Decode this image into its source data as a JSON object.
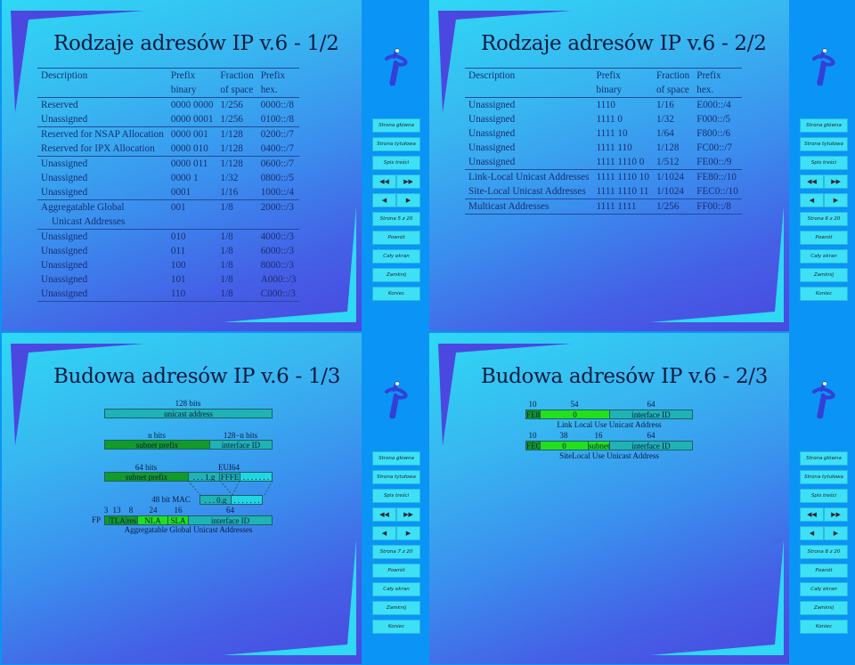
{
  "nav": {
    "home": "Strona główna",
    "title_page": "Strona tytułowa",
    "toc": "Spis treści",
    "first": "◀◀",
    "last": "▶▶",
    "prev": "◀",
    "next": "▶",
    "back": "Powrót",
    "fullscreen": "Cały ekran",
    "close": "Zamknij",
    "end": "Koniec"
  },
  "colors": {
    "sidebar": "#0a94f5",
    "button": "#3ee0f5",
    "teal": "#1fb3b5",
    "dark_green": "#129b28",
    "light_green": "#22e01e"
  },
  "slides": [
    {
      "title": "Rodzaje adresów IP v.6 - 1/2",
      "page": "Strona 5 z 20",
      "headers": [
        [
          "Description",
          ""
        ],
        [
          "Prefix",
          "binary"
        ],
        [
          "Fraction",
          "of space"
        ],
        [
          "Prefix",
          "hex."
        ]
      ],
      "rows": [
        [
          "Reserved",
          "0000 0000",
          "1/256",
          "0000::/8"
        ],
        [
          "Unassigned",
          "0000 0001",
          "1/256",
          "0100::/8"
        ],
        [
          "Reserved for NSAP Allocation",
          "0000 001",
          "1/128",
          "0200::/7"
        ],
        [
          "Reserved for IPX Allocation",
          "0000 010",
          "1/128",
          "0400::/7"
        ],
        [
          "Unassigned",
          "0000 011",
          "1/128",
          "0600::/7"
        ],
        [
          "Unassigned",
          "0000 1",
          "1/32",
          "0800::/5"
        ],
        [
          "Unassigned",
          "0001",
          "1/16",
          "1000::/4"
        ],
        [
          "Aggregatable Global",
          "001",
          "1/8",
          "2000::/3"
        ],
        [
          "  Unicast Addresses",
          "",
          "",
          ""
        ],
        [
          "Unassigned",
          "010",
          "1/8",
          "4000::/3"
        ],
        [
          "Unassigned",
          "011",
          "1/8",
          "6000::/3"
        ],
        [
          "Unassigned",
          "100",
          "1/8",
          "8000::/3"
        ],
        [
          "Unassigned",
          "101",
          "1/8",
          "A000::/3"
        ],
        [
          "Unassigned",
          "110",
          "1/8",
          "C000::/3"
        ]
      ]
    },
    {
      "title": "Rodzaje adresów IP v.6 - 2/2",
      "page": "Strona 6 z 20",
      "headers": [
        [
          "Description",
          ""
        ],
        [
          "Prefix",
          "binary"
        ],
        [
          "Fraction",
          "of space"
        ],
        [
          "Prefix",
          "hex."
        ]
      ],
      "rows": [
        [
          "Unassigned",
          "1110",
          "1/16",
          "E000::/4"
        ],
        [
          "Unassigned",
          "1111 0",
          "1/32",
          "F000::/5"
        ],
        [
          "Unassigned",
          "1111 10",
          "1/64",
          "F800::/6"
        ],
        [
          "Unassigned",
          "1111 110",
          "1/128",
          "FC00::/7"
        ],
        [
          "Unassigned",
          "1111 1110 0",
          "1/512",
          "FE00::/9"
        ],
        [
          "Link-Local Unicast Addresses",
          "1111 1110 10",
          "1/1024",
          "FE80::/10"
        ],
        [
          "Site-Local Unicast Addresses",
          "1111 1110 11",
          "1/1024",
          "FEC0::/10"
        ],
        [
          "Multicast Addresses",
          "1111 1111",
          "1/256",
          "FF00::/8"
        ]
      ]
    },
    {
      "title": "Budowa adresów IP v.6 - 1/3",
      "page": "Strona 7 z 20",
      "diagram": {
        "bits128": "128 bits",
        "unicast": "unicast address",
        "nbits": "n bits",
        "n128": "128−n bits",
        "subnet_prefix": "subnet prefix",
        "interface_id": "interface ID",
        "bits64": "64 bits",
        "eui64": "EUI64",
        "subnet_prefix2": "subnet prefix",
        "dots1g": ". . . 1.g",
        "fffe": "FFFE",
        "dots_end": ". . . . . . .",
        "mac": "48 bit MAC",
        "dots0g": ". . . 0.g",
        "dots_mac_end": ". . . . . . .",
        "n3": "3",
        "n13": "13",
        "n8": "8",
        "n24": "24",
        "n16": "16",
        "n64": "64",
        "fp": "FP",
        "tla": "TLA",
        "res": "res",
        "nla": "NLA",
        "sla": "SLA",
        "interface_id2": "interface ID",
        "caption": "Aggregatable Global Unicast Addresses"
      }
    },
    {
      "title": "Budowa adresów IP v.6 - 2/3",
      "page": "Strona 8 z 20",
      "diagram": {
        "l1_10": "10",
        "l1_54": "54",
        "l1_64": "64",
        "fe8": "FE8",
        "zero": "0",
        "interface_id": "interface ID",
        "caption1": "Link Local Use Unicast Address",
        "l2_10": "10",
        "l2_38": "38",
        "l2_16": "16",
        "l2_64": "64",
        "fec": "FEC",
        "zero2": "0",
        "subnet": "subnet",
        "interface_id2": "interface ID",
        "caption2": "SiteLocal Use Unicast Address"
      }
    }
  ]
}
